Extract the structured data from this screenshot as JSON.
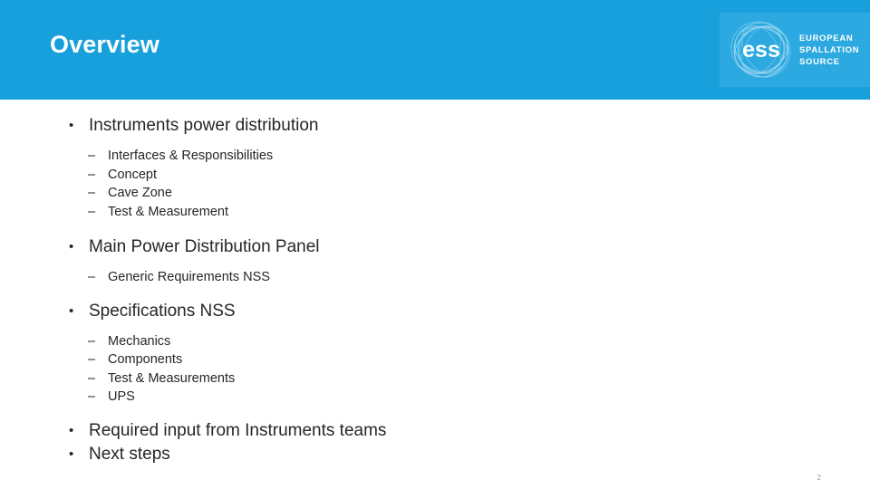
{
  "header": {
    "title": "Overview",
    "banner_color": "#17A0DB",
    "logo_box_color": "#2BA9E0",
    "logo": {
      "mark_text": "ess",
      "line1": "EUROPEAN",
      "line2": "SPALLATION",
      "line3": "SOURCE"
    }
  },
  "content": {
    "groups": [
      {
        "bullet": "•",
        "text": "Instruments power distribution",
        "sub_marker": "–",
        "subs": [
          "Interfaces & Responsibilities",
          "Concept",
          "Cave Zone",
          "Test & Measurement"
        ]
      },
      {
        "bullet": "•",
        "text": "Main Power Distribution Panel",
        "sub_marker": "–",
        "subs": [
          "Generic Requirements NSS"
        ]
      },
      {
        "bullet": "•",
        "text": "Specifications NSS",
        "sub_marker": "–",
        "subs": [
          "Mechanics",
          "Components",
          "Test & Measurements",
          "UPS"
        ]
      },
      {
        "bullet": "•",
        "text": "Required input from Instruments teams",
        "sub_marker": "–",
        "subs": []
      },
      {
        "bullet": "•",
        "text": "Next steps",
        "sub_marker": "–",
        "subs": []
      }
    ]
  },
  "footer": {
    "slide_number": "2"
  },
  "colors": {
    "banner": "#17A0DB",
    "logo_box": "#2BA9E0",
    "text": "#262626",
    "slide_number": "#9a9a9a"
  }
}
